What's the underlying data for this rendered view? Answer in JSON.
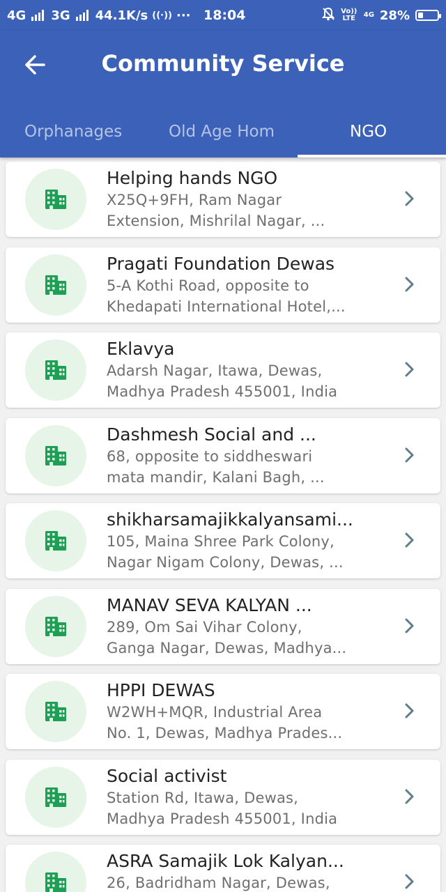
{
  "status_bar": {
    "left_1": "4G",
    "left_2": "3G",
    "speed": "44.1K/s",
    "more": "···",
    "time": "18:04",
    "volte": "Vo)) LTE",
    "network": "4G",
    "battery": "28%",
    "battery_level": 0.28
  },
  "app_bar": {
    "title": "Community Service",
    "back_icon": "arrow-left-icon"
  },
  "tabs": [
    {
      "label": "Orphanages",
      "active": false
    },
    {
      "label": "Old Age Hom",
      "active": false
    },
    {
      "label": "NGO",
      "active": true
    }
  ],
  "colors": {
    "primary": "#3b62b8",
    "icon_green": "#1e9f55",
    "avatar_bg": "#e6f5e8",
    "chevron": "#5f7c8a"
  },
  "list": {
    "item_icon": "building-icon",
    "chevron_icon": "chevron-right-icon",
    "items": [
      {
        "name": "Helping hands NGO",
        "address_line1": "X25Q+9FH, Ram Nagar",
        "address_line2": "Extension, Mishrilal Nagar, ..."
      },
      {
        "name": "Pragati Foundation Dewas",
        "address_line1": "5-A Kothi Road, opposite to",
        "address_line2": "Khedapati International Hotel,..."
      },
      {
        "name": "Eklavya",
        "address_line1": "Adarsh Nagar, Itawa, Dewas,",
        "address_line2": "Madhya Pradesh 455001, India"
      },
      {
        "name": "Dashmesh Social and ...",
        "address_line1": "68, opposite to siddheswari",
        "address_line2": "mata mandir, Kalani Bagh, ..."
      },
      {
        "name": "shikharsamajikkalyansami...",
        "address_line1": "105, Maina Shree Park Colony,",
        "address_line2": "Nagar Nigam Colony, Dewas, ..."
      },
      {
        "name": "MANAV SEVA KALYAN ...",
        "address_line1": "289, Om Sai Vihar Colony,",
        "address_line2": "Ganga Nagar, Dewas, Madhya..."
      },
      {
        "name": "HPPI DEWAS",
        "address_line1": "W2WH+MQR, Industrial Area",
        "address_line2": "No. 1, Dewas, Madhya Prades..."
      },
      {
        "name": "Social activist",
        "address_line1": "Station Rd, Itawa, Dewas,",
        "address_line2": "Madhya Pradesh 455001, India"
      },
      {
        "name": "ASRA Samajik Lok Kalyan...",
        "address_line1": "26, Badridham Nagar, Dewas,",
        "address_line2": ""
      }
    ]
  }
}
